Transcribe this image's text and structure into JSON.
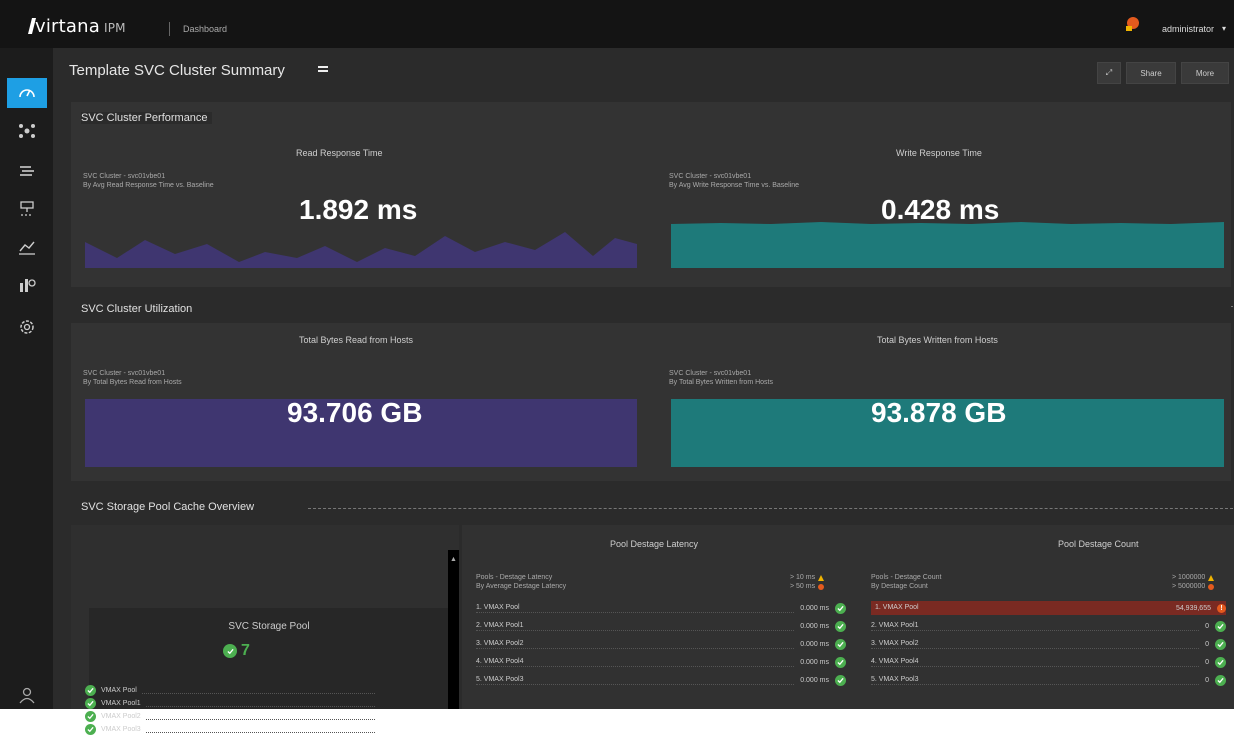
{
  "app": {
    "brand": "virtana",
    "product": "IPM",
    "crumb": "Dashboard",
    "user": "administrator",
    "user_caret": "▾"
  },
  "colors": {
    "accent": "#1e9fe4",
    "purple": "#3f3670",
    "teal": "#1e7a7a",
    "ok": "#4caf50",
    "warn": "#f0b400",
    "critical": "#e35a1e"
  },
  "nav": {
    "icons": [
      "dashboard-icon",
      "topology-icon",
      "inventory-icon",
      "network-icon",
      "analytics-icon",
      "reports-icon",
      "settings-icon",
      "user-icon"
    ]
  },
  "page": {
    "title": "Template   SVC Cluster Summary",
    "toolbar": {
      "fullscreen": "⤢",
      "share": "Share",
      "more": "More"
    }
  },
  "performance": {
    "title": "SVC Cluster Performance",
    "read": {
      "title": "Read Response Time",
      "subtitle_1": "SVC Cluster - svc01vbe01",
      "subtitle_2": "By Avg Read Response Time vs. Baseline",
      "value": "1.892 ms"
    },
    "write": {
      "title": "Write Response Time",
      "subtitle_1": "SVC Cluster - svc01vbe01",
      "subtitle_2": "By Avg Write Response Time vs. Baseline",
      "value": "0.428 ms"
    }
  },
  "utilization": {
    "title": "SVC Cluster Utilization",
    "read": {
      "title": "Total Bytes Read from Hosts",
      "subtitle_1": "SVC Cluster - svc01vbe01",
      "subtitle_2": "By Total Bytes Read from Hosts",
      "value": "93.706 GB"
    },
    "write": {
      "title": "Total Bytes Written from Hosts",
      "subtitle_1": "SVC Cluster - svc01vbe01",
      "subtitle_2": "By Total Bytes Written from Hosts",
      "value": "93.878 GB"
    }
  },
  "pools": {
    "title": "SVC Storage Pool Cache Overview",
    "card_title": "SVC Storage Pool",
    "count": "7",
    "list": [
      "VMAX Pool",
      "VMAX Pool1",
      "VMAX Pool2",
      "VMAX Pool3"
    ],
    "latency": {
      "title": "Pool Destage Latency",
      "sub_1": "Pools - Destage Latency",
      "sub_2": "By Average Destage Latency",
      "legend_warn": "> 10 ms",
      "legend_crit": "> 50 ms",
      "rows": [
        {
          "label": "1. VMAX Pool",
          "value": "0.000 ms",
          "status": "ok"
        },
        {
          "label": "2. VMAX Pool1",
          "value": "0.000 ms",
          "status": "ok"
        },
        {
          "label": "3. VMAX Pool2",
          "value": "0.000 ms",
          "status": "ok"
        },
        {
          "label": "4. VMAX Pool4",
          "value": "0.000 ms",
          "status": "ok"
        },
        {
          "label": "5. VMAX Pool3",
          "value": "0.000 ms",
          "status": "ok"
        }
      ]
    },
    "count_panel": {
      "title": "Pool Destage Count",
      "sub_1": "Pools - Destage Count",
      "sub_2": "By Destage Count",
      "legend_warn": "> 1000000",
      "legend_crit": "> 5000000",
      "rows": [
        {
          "label": "1. VMAX Pool",
          "value": "54,939,655",
          "status": "critical"
        },
        {
          "label": "2. VMAX Pool1",
          "value": "0",
          "status": "ok"
        },
        {
          "label": "3. VMAX Pool2",
          "value": "0",
          "status": "ok"
        },
        {
          "label": "4. VMAX Pool4",
          "value": "0",
          "status": "ok"
        },
        {
          "label": "5. VMAX Pool3",
          "value": "0",
          "status": "ok"
        }
      ]
    }
  }
}
